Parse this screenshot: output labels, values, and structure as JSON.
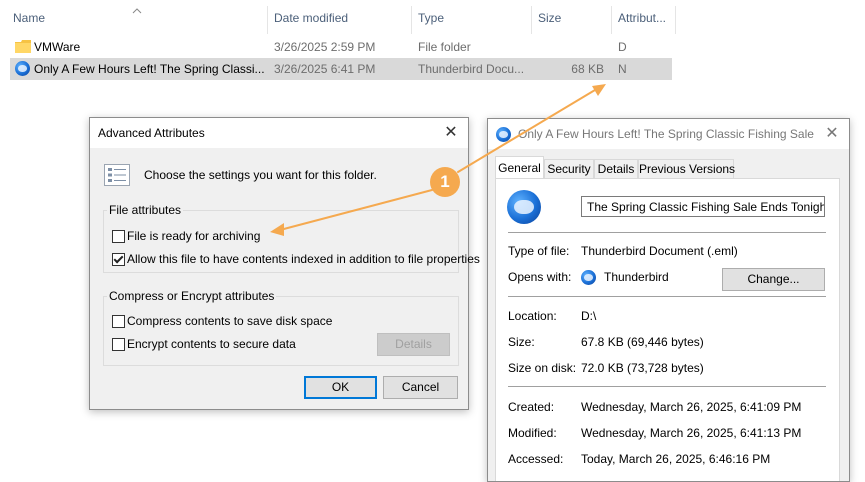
{
  "explorer": {
    "columns": {
      "name": "Name",
      "date_modified": "Date modified",
      "type": "Type",
      "size": "Size",
      "attributes": "Attribut..."
    },
    "rows": [
      {
        "name": "VMWare",
        "date": "3/26/2025 2:59 PM",
        "type": "File folder",
        "size": "",
        "attr": "D",
        "icon": "folder-icon",
        "selected": false
      },
      {
        "name": "Only A Few Hours Left! The Spring Classi...",
        "date": "3/26/2025 6:41 PM",
        "type": "Thunderbird Docu...",
        "size": "68 KB",
        "attr": "N",
        "icon": "thunderbird-icon",
        "selected": true
      }
    ]
  },
  "advanced": {
    "title": "Advanced Attributes",
    "close": "✕",
    "description": "Choose the settings you want for this folder.",
    "file_attributes_label": "File attributes",
    "archive_label": "File is ready for archiving",
    "archive_checked": false,
    "index_label": "Allow this file to have contents indexed in addition to file properties",
    "index_checked": true,
    "compress_group_label": "Compress or Encrypt attributes",
    "compress_label": "Compress contents to save disk space",
    "compress_checked": false,
    "encrypt_label": "Encrypt contents to secure data",
    "encrypt_checked": false,
    "details_button": "Details",
    "ok_button": "OK",
    "cancel_button": "Cancel"
  },
  "properties": {
    "title": "Only A Few Hours Left! The Spring Classic Fishing Sale ...",
    "close": "✕",
    "tabs": [
      "General",
      "Security",
      "Details",
      "Previous Versions"
    ],
    "filename": "The Spring Classic Fishing Sale Ends Tonight!.eml",
    "type_key": "Type of file:",
    "type_val": "Thunderbird Document (.eml)",
    "opens_key": "Opens with:",
    "opens_val": "Thunderbird",
    "change_button": "Change...",
    "location_key": "Location:",
    "location_val": "D:\\",
    "size_key": "Size:",
    "size_val": "67.8 KB (69,446 bytes)",
    "disk_key": "Size on disk:",
    "disk_val": "72.0 KB (73,728 bytes)",
    "created_key": "Created:",
    "created_val": "Wednesday, March 26, 2025, 6:41:09 PM",
    "modified_key": "Modified:",
    "modified_val": "Wednesday, March 26, 2025, 6:41:13 PM",
    "accessed_key": "Accessed:",
    "accessed_val": "Today, March 26, 2025, 6:46:16 PM"
  },
  "annotation": {
    "badge": "1",
    "color": "#f5a94f"
  }
}
